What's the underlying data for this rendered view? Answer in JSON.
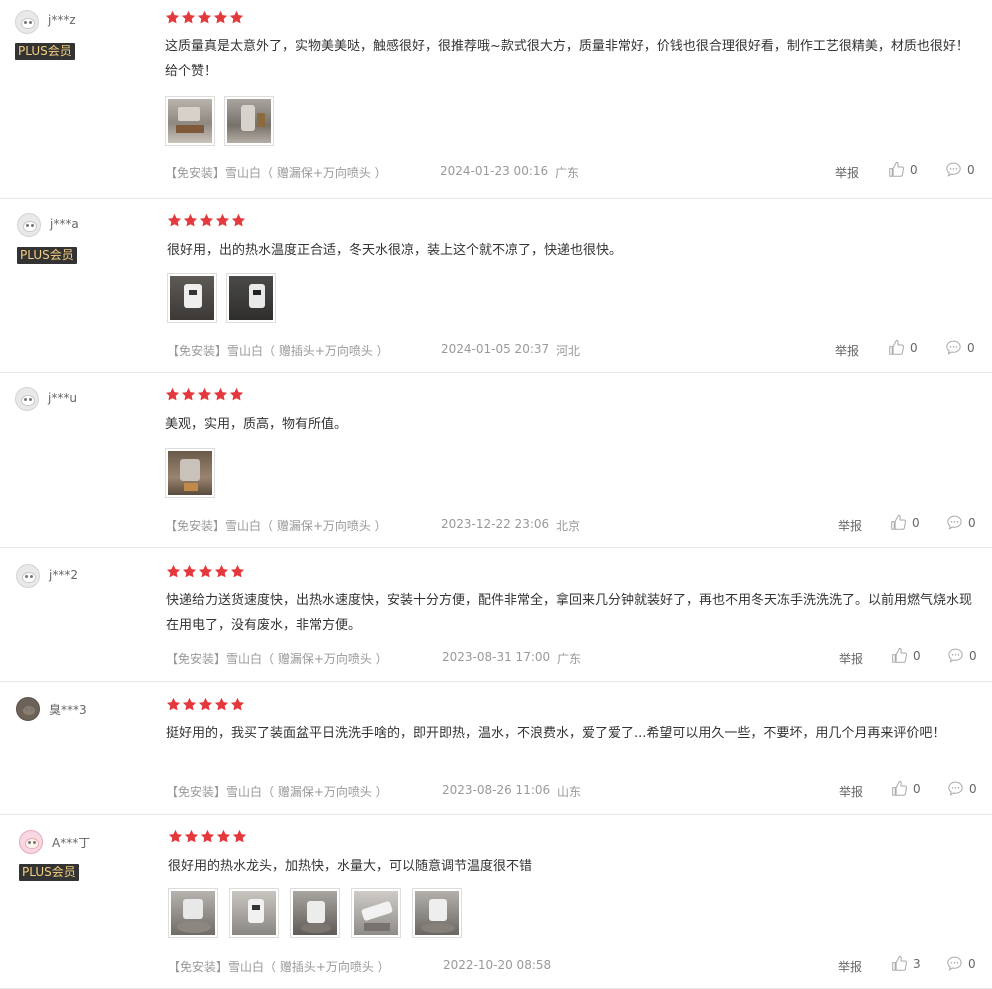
{
  "reviews": [
    {
      "username": "j***z",
      "plus": "PLUS会员",
      "rating": 5,
      "content": "这质量真是太意外了，实物美美哒，触感很好，很推荐哦~款式很大方，质量非常好，价钱也很合理很好看，制作工艺很精美，材质也很好！给个赞！",
      "images": 2,
      "spec": "【免安装】雪山白（ 赠漏保+万向喷头 ）",
      "date": "2024-01-23 00:16",
      "region": "广东",
      "report": "举报",
      "likes": "0",
      "replies": "0"
    },
    {
      "username": "j***a",
      "plus": "PLUS会员",
      "rating": 5,
      "content": "很好用，出的热水温度正合适，冬天水很凉，装上这个就不凉了，快递也很快。",
      "images": 2,
      "spec": "【免安装】雪山白（ 赠插头+万向喷头 ）",
      "date": "2024-01-05 20:37",
      "region": "河北",
      "report": "举报",
      "likes": "0",
      "replies": "0"
    },
    {
      "username": "j***u",
      "plus": "",
      "rating": 5,
      "content": "美观，实用，质高，物有所值。",
      "images": 1,
      "spec": "【免安装】雪山白（ 赠漏保+万向喷头 ）",
      "date": "2023-12-22 23:06",
      "region": "北京",
      "report": "举报",
      "likes": "0",
      "replies": "0"
    },
    {
      "username": "j***2",
      "plus": "",
      "rating": 5,
      "content": "快递给力送货速度快，出热水速度快，安装十分方便，配件非常全，拿回来几分钟就装好了，再也不用冬天冻手洗洗洗了。以前用燃气烧水现在用电了，没有废水，非常方便。",
      "images": 0,
      "spec": "【免安装】雪山白（ 赠漏保+万向喷头 ）",
      "date": "2023-08-31 17:00",
      "region": "广东",
      "report": "举报",
      "likes": "0",
      "replies": "0"
    },
    {
      "username": "臭***3",
      "plus": "",
      "rating": 5,
      "content": "挺好用的，我买了装面盆平日洗洗手啥的，即开即热，温水，不浪费水，爱了爱了...希望可以用久一些，不要坏，用几个月再来评价吧！",
      "images": 0,
      "spec": "【免安装】雪山白（ 赠漏保+万向喷头 ）",
      "date": "2023-08-26 11:06",
      "region": "山东",
      "report": "举报",
      "likes": "0",
      "replies": "0"
    },
    {
      "username": "A***丁",
      "plus": "PLUS会员",
      "rating": 5,
      "content": "很好用的热水龙头，加热快，水量大，可以随意调节温度很不错",
      "images": 5,
      "spec": "【免安装】雪山白（ 赠插头+万向喷头 ）",
      "date": "2022-10-20 08:58",
      "region": "",
      "report": "举报",
      "likes": "3",
      "replies": "0"
    }
  ],
  "colors": {
    "star": "#e4393c",
    "plus_bg": "#333333",
    "plus_text": "#f3cf7f"
  }
}
